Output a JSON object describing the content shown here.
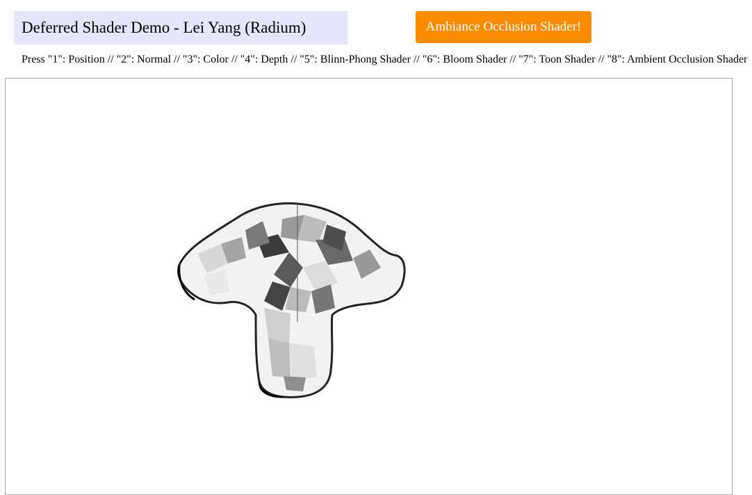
{
  "header": {
    "title": "Deferred Shader Demo - Lei Yang (Radium)",
    "shader_button_label": "Ambiance Occlusion Shader!"
  },
  "instructions": {
    "text": "Press \"1\": Position // \"2\": Normal // \"3\": Color // \"4\": Depth // \"5\": Blinn-Phong Shader // \"6\": Bloom Shader // \"7\": Toon Shader // \"8\": Ambient Occlusion Shader"
  },
  "colors": {
    "title_background": "#e6e6fa",
    "button_background": "#ff8c00",
    "button_text": "#ffffff"
  },
  "canvas": {
    "model": "suzanne-monkey-head",
    "active_mode": "ambient-occlusion"
  }
}
